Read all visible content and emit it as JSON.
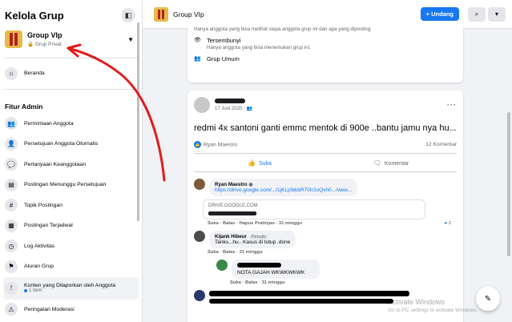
{
  "sidebar": {
    "title": "Kelola Grup",
    "group": {
      "name": "Group VIp",
      "privacy": "Grup Privat"
    },
    "home": "Beranda",
    "section": "Fitur Admin",
    "items": [
      {
        "label": "Permintaan Anggota",
        "icon": "member-request-icon"
      },
      {
        "label": "Persetujuan Anggota Otomatis",
        "icon": "auto-approve-icon"
      },
      {
        "label": "Pertanyaan Keanggotaan",
        "icon": "question-icon"
      },
      {
        "label": "Postingan Menunggu Persetujuan",
        "icon": "pending-posts-icon"
      },
      {
        "label": "Topik Postingan",
        "icon": "topic-icon"
      },
      {
        "label": "Postingan Terjadwal",
        "icon": "calendar-icon"
      },
      {
        "label": "Log Aktivitas",
        "icon": "activity-log-icon"
      },
      {
        "label": "Aturan Grup",
        "icon": "rules-icon"
      },
      {
        "label": "Konten yang Dilaporkan oleh Anggota",
        "icon": "report-icon",
        "sub": "1 item"
      },
      {
        "label": "Peringatan Moderasi",
        "icon": "warning-icon"
      }
    ]
  },
  "topbar": {
    "title": "Group VIp",
    "join_label": "+ Undang"
  },
  "about": {
    "private_desc": "Hanya anggota yang bisa melihat siapa anggota grup ini dan apa yang diposting.",
    "hidden_title": "Tersembunyi",
    "hidden_desc": "Hanya anggota yang bisa menemukan grup ini.",
    "general": "Grup Umum"
  },
  "post": {
    "time": "17 Juni 2020 · ",
    "text": "redmi 4x santoni ganti emmc mentok di 900e ..bantu jamu nya hu...",
    "liker": "Ryan Maestro",
    "comments_count": "12 Komentar",
    "like_label": "Suka",
    "comment_label": "Komentar"
  },
  "comments": [
    {
      "name": "Ryan Maestro",
      "link": "https://drive.google.com/.../1jKLpIbkbR70Ir2oQvh0.../view...",
      "preview_domain": "DRIVE.GOOGLE.COM",
      "meta": "Suka · Balas · Hapus Pratinjau · 31 minggu",
      "reactions": "2"
    },
    {
      "name": "Kijank Hibeur",
      "badge": "Penulis",
      "text": "Tanks...hu.. Kasus di tutup .done",
      "meta": "Suka · Balas · 31 minggu"
    },
    {
      "text": "NOTA GAJAH WKWKWKWK",
      "meta": "Suka · Balas · 31 minggu"
    }
  ],
  "watermark": {
    "line1": "Activate Windows",
    "line2": "Go to PC settings to activate Windows."
  },
  "colors": {
    "accent": "#1877f2",
    "annotation": "#e31b1b"
  }
}
